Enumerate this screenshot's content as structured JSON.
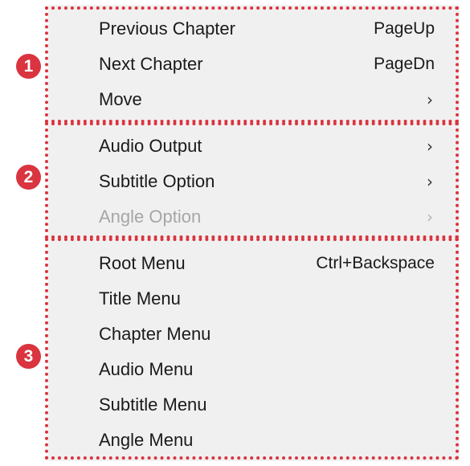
{
  "colors": {
    "accent": "#d9343f",
    "menu_background": "#f0f0f0",
    "text": "#1a1a1a",
    "disabled_text": "#a6a6a6"
  },
  "badges": [
    "1",
    "2",
    "3"
  ],
  "sections": [
    {
      "items": [
        {
          "label": "Previous Chapter",
          "shortcut": "PageUp"
        },
        {
          "label": "Next Chapter",
          "shortcut": "PageDn"
        },
        {
          "label": "Move",
          "submenu_icon": "chevron-right-icon"
        }
      ]
    },
    {
      "items": [
        {
          "label": "Audio Output",
          "submenu_icon": "chevron-right-icon"
        },
        {
          "label": "Subtitle Option",
          "submenu_icon": "chevron-right-icon"
        },
        {
          "label": "Angle Option",
          "submenu_icon": "chevron-right-icon",
          "disabled": true
        }
      ]
    },
    {
      "items": [
        {
          "label": "Root Menu",
          "shortcut": "Ctrl+Backspace"
        },
        {
          "label": "Title Menu"
        },
        {
          "label": "Chapter Menu"
        },
        {
          "label": "Audio Menu"
        },
        {
          "label": "Subtitle Menu"
        },
        {
          "label": "Angle Menu"
        }
      ]
    }
  ]
}
